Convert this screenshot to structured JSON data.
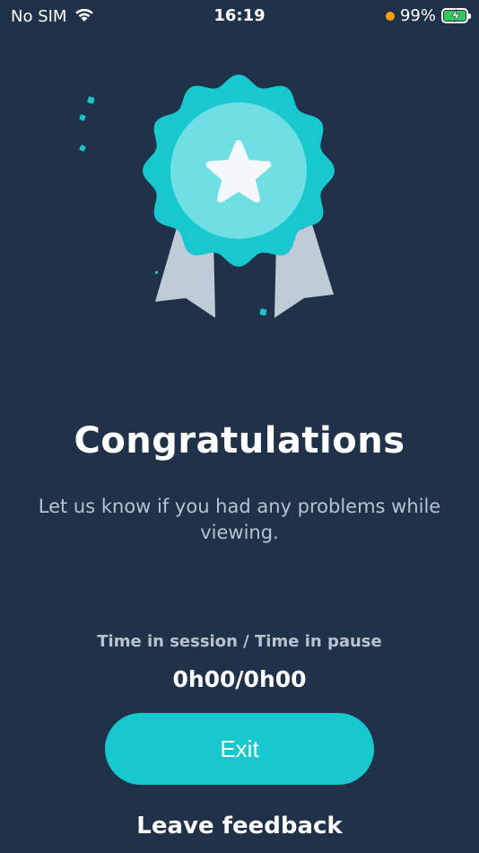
{
  "status_bar": {
    "carrier": "No SIM",
    "time": "16:19",
    "battery": "99%",
    "battery_level": 0.99,
    "accent_colors": {
      "battery_fill": "#34c759",
      "privacy_dot": "#ff9f0a"
    },
    "icons": [
      "wifi-icon",
      "battery-icon"
    ]
  },
  "medal": {
    "icon": "award-medal-star-icon",
    "colors": {
      "rosette": "#17c8cf",
      "inner_circle": "#6fdfe3",
      "star": "#f4f8fb",
      "ribbon": "#bfcbd6"
    }
  },
  "main": {
    "title": "Congratulations",
    "subtitle": "Let us know if you had any problems while viewing.",
    "time_label": "Time in session / Time in pause",
    "time_value": "0h00/0h00"
  },
  "actions": {
    "exit_label": "Exit",
    "feedback_label": "Leave feedback"
  },
  "theme": {
    "background": "#20324a",
    "primary": "#17c8cf"
  }
}
